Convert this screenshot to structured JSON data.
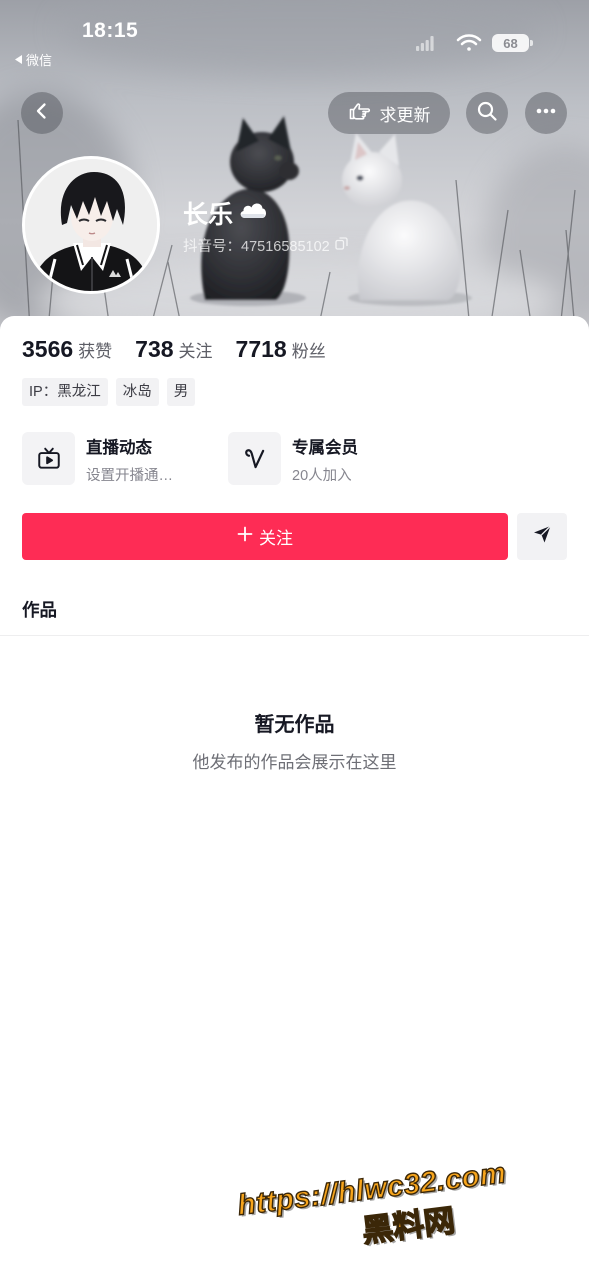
{
  "status_bar": {
    "time": "18:15",
    "back_app_label": "微信",
    "battery_level": "68"
  },
  "top_bar": {
    "request_update_label": "求更新"
  },
  "profile": {
    "name": "长乐",
    "douyin_id": "抖音号：47516585102"
  },
  "stats": [
    {
      "value": "3566",
      "label": "获赞"
    },
    {
      "value": "738",
      "label": "关注"
    },
    {
      "value": "7718",
      "label": "粉丝"
    }
  ],
  "tags": [
    {
      "label": "IP：黑龙江"
    },
    {
      "label": "冰岛"
    },
    {
      "label": "男"
    }
  ],
  "features": [
    {
      "title": "直播动态",
      "subtitle": "设置开播通…",
      "icon": "live-tv-icon"
    },
    {
      "title": "专属会员",
      "subtitle": "20人加入",
      "icon": "member-v-icon"
    }
  ],
  "actions": {
    "follow_label": "关注"
  },
  "tabs": [
    {
      "label": "作品"
    }
  ],
  "empty_state": {
    "title": "暂无作品",
    "subtitle": "他发布的作品会展示在这里"
  },
  "watermark": {
    "url": "https://hlwc32.com",
    "site_name": "黑料网"
  },
  "icons": {
    "back": "chevron-left-icon",
    "request_update": "pointing-hand-icon",
    "search": "search-icon",
    "more": "more-dots-icon",
    "copy": "copy-icon",
    "name_badge": "cloud-icon",
    "follow": "plus-icon",
    "share": "paper-plane-icon"
  },
  "colors": {
    "accent": "#fe2c55",
    "text_primary": "#161823",
    "text_secondary": "#86868f",
    "chip_background": "#f2f2f4",
    "watermark": "#f7a51c"
  }
}
